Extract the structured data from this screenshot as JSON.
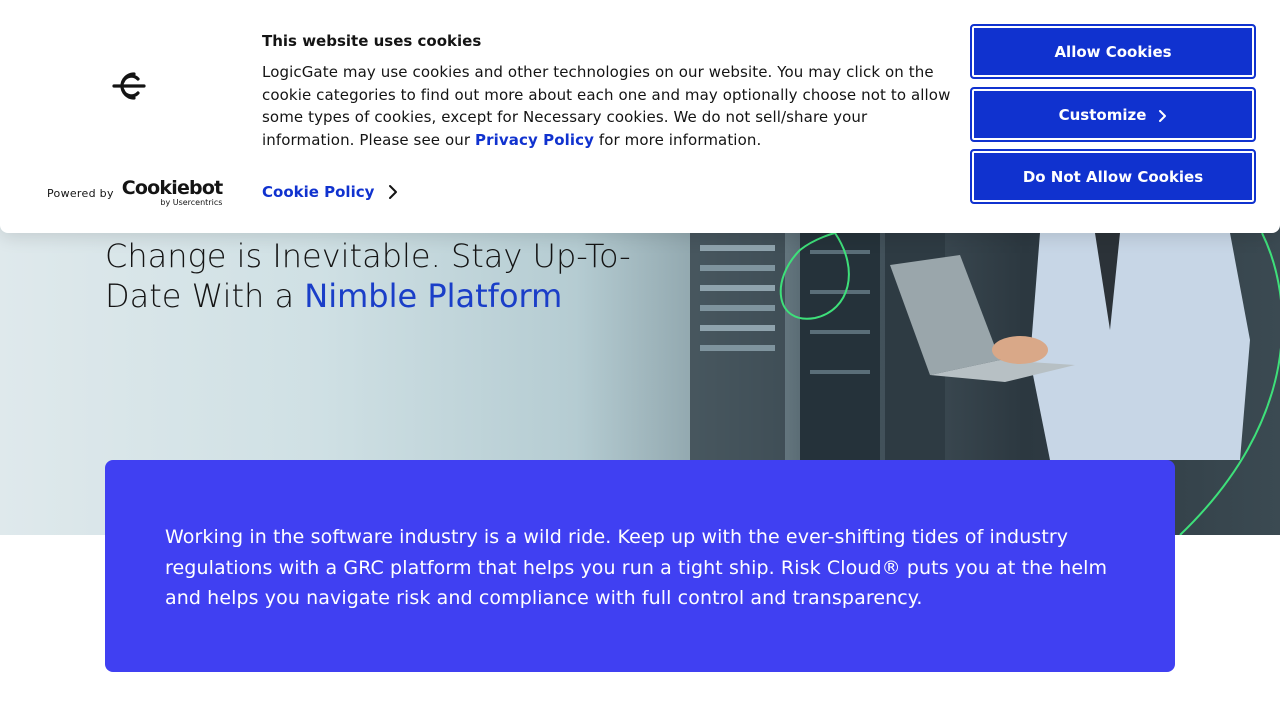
{
  "hero": {
    "heading_part1": "Change is Inevitable. Stay Up-To-Date With a ",
    "heading_accent": "Nimble Platform"
  },
  "card": {
    "text": "Working in the software industry is a wild ride. Keep up with the ever-shifting tides of industry regulations with a GRC platform that helps you run a tight ship. Risk Cloud® puts you at the helm and helps you navigate risk and compliance with full control and transparency."
  },
  "cookie_banner": {
    "title": "This website uses cookies",
    "body_before_link": "LogicGate may use cookies and other technologies on our website. You may click on the cookie categories to find out more about each one and may optionally choose not to allow some types of cookies, except for Necessary cookies.  We do not sell/share your information. Please see our ",
    "privacy_link": "Privacy Policy",
    "body_after_link": " for more information.",
    "cookie_policy_link": "Cookie Policy",
    "powered_by": "Powered by",
    "cookiebot_name": "Cookiebot",
    "cookiebot_sub": "by Usercentrics",
    "buttons": {
      "allow": "Allow Cookies",
      "customize": "Customize",
      "deny": "Do Not Allow Cookies"
    }
  },
  "colors": {
    "brand_blue": "#1032cf",
    "card_purple": "#4040f2",
    "accent_green": "#3ee07a"
  },
  "icons": {
    "logo": "logicgate-logo-icon",
    "chevron": "chevron-right-icon"
  }
}
